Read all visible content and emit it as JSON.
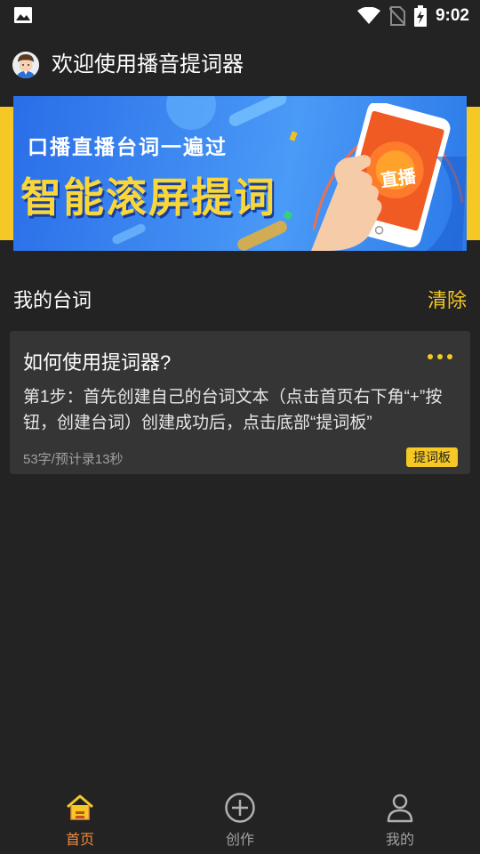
{
  "status_bar": {
    "time": "9:02",
    "icons": [
      "image-icon",
      "wifi-icon",
      "no-sim-icon",
      "battery-charging-icon"
    ]
  },
  "header": {
    "title": "欢迎使用播音提词器",
    "avatar_icon": "avatar-icon"
  },
  "banner": {
    "line1": "口播直播台词一遍过",
    "line2": "智能滚屏提词",
    "phone_label": "直播"
  },
  "section": {
    "title": "我的台词",
    "clear_label": "清除"
  },
  "scripts": [
    {
      "title": "如何使用提词器?",
      "body": "第1步：首先创建自己的台词文本（点击首页右下角“+”按钮，创建台词）创建成功后，点击底部“提词板”",
      "meta": "53字/预计录13秒",
      "tag": "提词板"
    }
  ],
  "bottom_nav": {
    "items": [
      {
        "label": "首页",
        "icon": "home-icon",
        "active": true
      },
      {
        "label": "创作",
        "icon": "add-circle-icon",
        "active": false
      },
      {
        "label": "我的",
        "icon": "user-icon",
        "active": false
      }
    ]
  },
  "colors": {
    "accent": "#f5c826",
    "background": "#232323",
    "card": "#353535",
    "active_nav": "#f08a3c"
  }
}
